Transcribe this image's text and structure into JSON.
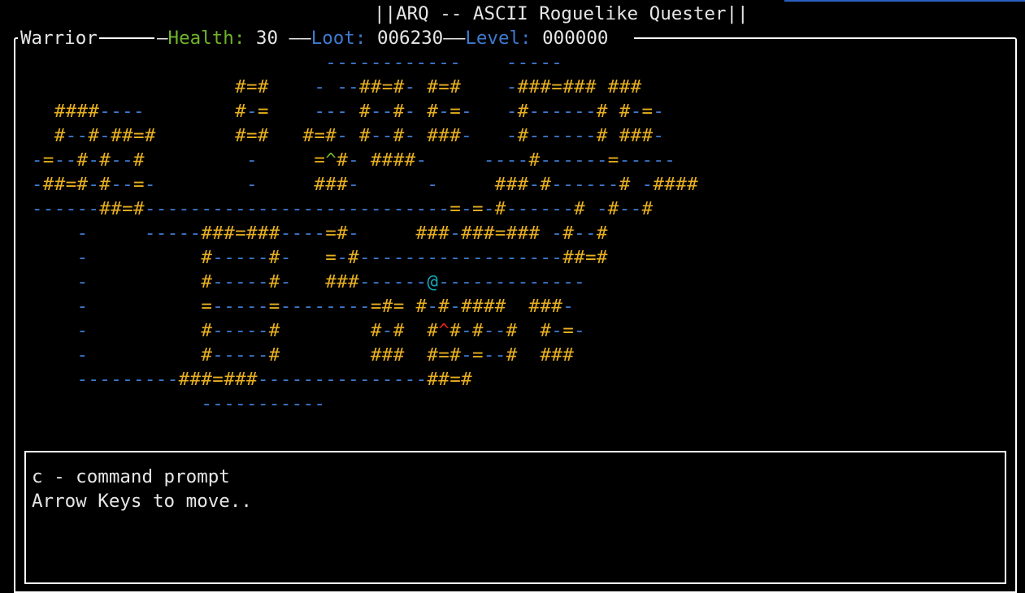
{
  "title": "||ARQ -- ASCII Roguelike Quester||",
  "hud": {
    "class_name": "Warrior",
    "health_label": "Health:",
    "health_value": "30",
    "loot_label": "Loot:",
    "loot_value": "006230",
    "level_label": "Level:",
    "level_value": "000000"
  },
  "colors": {
    "wall": "#e8b020",
    "floor": "#3f79cf",
    "player": "#11a6b8",
    "trap_red": "#e0201a",
    "trap_green": "#6fb32a",
    "health_label": "#6fb32a",
    "loot_label": "#3f79cf",
    "level_label": "#3f79cf",
    "text": "#e6e6e6",
    "accent": "#2a5fc4"
  },
  "map": {
    "rows": [
      "                           ------------    -----",
      "                   #=#    - --##=#- #=#    -###=### ###",
      "   ####----        #-=    --- #--#- #-=-   -#------# #-=-",
      "   #--#-##=#       #=#   #=#- #--#- ###-   -#------# ###-",
      " -=--#-#--#         -     =^#- ####-     ----#------=-----",
      " -##=#-#--=-        -     ###-      -     ###-#------# -####",
      " ------##=#---------------------------=-=-#------# -#--#",
      "     -     -----###=###----=#-     ###-###=### -#--#",
      "     -          #-----#-   =-#------------------##=#",
      "     -          #-----#-   ###------@-------------",
      "     -          =-----=--------=#= #-#-####  ###-",
      "     -          #-----#        #-#  #^#-#--#  #-=-",
      "     -          #-----#        ###  #=#-=--#  ###",
      "     ---------###=###---------------##=#",
      "                -----------"
    ]
  },
  "messages": [
    "c - command prompt",
    "Arrow Keys to move.."
  ]
}
